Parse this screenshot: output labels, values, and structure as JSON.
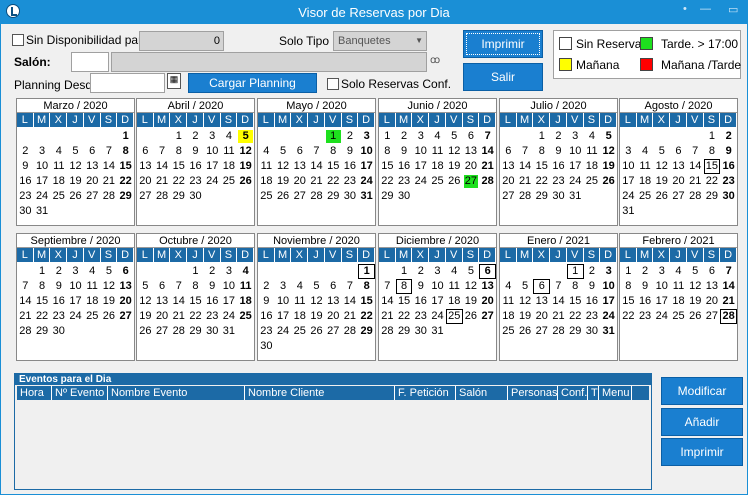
{
  "window": {
    "title": "Visor de Reservas por Dia"
  },
  "controls": {
    "sin_disponibilidad_label": "Sin Disponibilidad para",
    "sin_disponibilidad_value": "0",
    "solo_tipo_label": "Solo Tipo",
    "solo_tipo_value": "Banquetes",
    "salon_label": "Salón:",
    "planning_desde_label": "Planning Desde",
    "cargar_planning_label": "Cargar Planning",
    "solo_reservas_label": "Solo Reservas Conf.",
    "imprimir_label": "Imprimir",
    "salir_label": "Salir"
  },
  "legend": {
    "sin_reserva": "Sin Reserva",
    "tarde": "Tarde.  > 17:00",
    "manana": "Mañana",
    "manana_tarde": "Mañana /Tarde",
    "colors": {
      "sin_reserva": "#ffffff",
      "tarde": "#1ee01e",
      "manana": "#ffff00",
      "manana_tarde": "#ff0000"
    }
  },
  "weekdays": [
    "L",
    "M",
    "X",
    "J",
    "V",
    "S",
    "D"
  ],
  "calendars": [
    {
      "title": "Marzo / 2020",
      "offset": 6,
      "days": 31,
      "marks": {}
    },
    {
      "title": "Abril / 2020",
      "offset": 2,
      "days": 30,
      "marks": {
        "5": "yel"
      }
    },
    {
      "title": "Mayo / 2020",
      "offset": 4,
      "days": 31,
      "marks": {
        "1": "grn"
      }
    },
    {
      "title": "Junio / 2020",
      "offset": 0,
      "days": 30,
      "marks": {
        "27": "grn"
      }
    },
    {
      "title": "Julio / 2020",
      "offset": 2,
      "days": 31,
      "marks": {}
    },
    {
      "title": "Agosto / 2020",
      "offset": 5,
      "days": 31,
      "marks": {
        "15": "box"
      }
    },
    {
      "title": "Septiembre / 2020",
      "offset": 1,
      "days": 30,
      "marks": {}
    },
    {
      "title": "Octubre / 2020",
      "offset": 3,
      "days": 31,
      "marks": {}
    },
    {
      "title": "Noviembre / 2020",
      "offset": 6,
      "days": 30,
      "marks": {
        "1": "box"
      }
    },
    {
      "title": "Diciembre / 2020",
      "offset": 1,
      "days": 31,
      "marks": {
        "6": "box",
        "8": "box",
        "25": "box"
      }
    },
    {
      "title": "Enero / 2021",
      "offset": 4,
      "days": 31,
      "marks": {
        "1": "box",
        "6": "box"
      }
    },
    {
      "title": "Febrero / 2021",
      "offset": 0,
      "days": 28,
      "marks": {
        "28": "box"
      }
    }
  ],
  "events": {
    "title": "Eventos para el Dia",
    "columns": [
      "Hora",
      "Nº Evento",
      "Nombre Evento",
      "Nombre Cliente",
      "F. Petición",
      "Salón",
      "Personas",
      "Conf.",
      "T",
      "Menu"
    ]
  },
  "side_buttons": {
    "modificar": "Modificar",
    "anadir": "Añadir",
    "imprimir": "Imprimir"
  }
}
